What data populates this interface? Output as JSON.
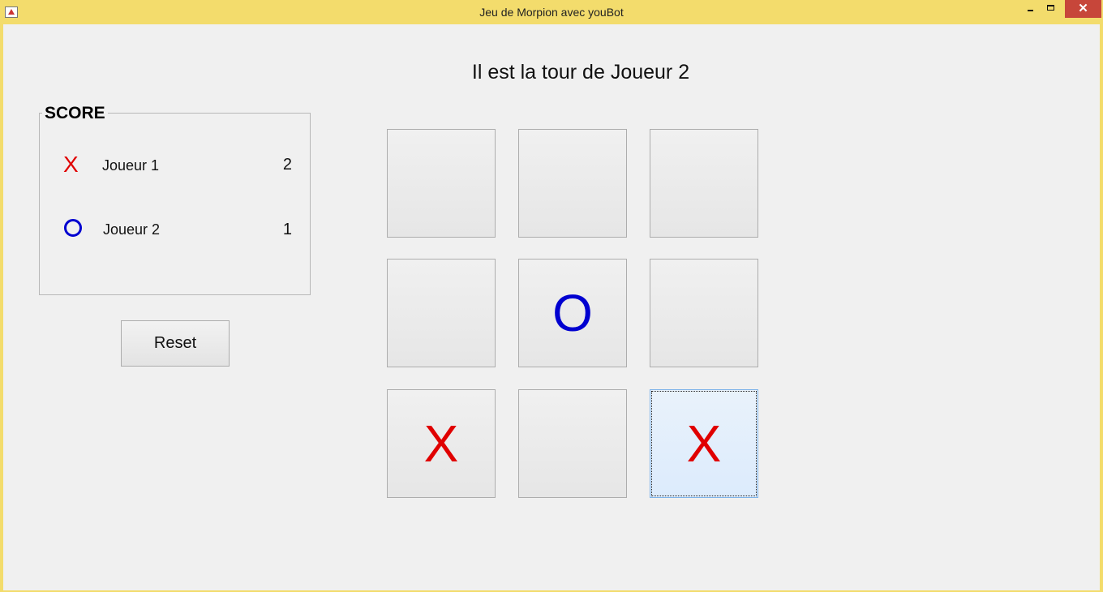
{
  "window": {
    "title": "Jeu de Morpion avec youBot",
    "close_label": "✕"
  },
  "status": {
    "turn_text": "Il est la tour de Joueur 2"
  },
  "score": {
    "title": "SCORE",
    "players": [
      {
        "symbol": "X",
        "name": "Joueur 1",
        "score": "2",
        "color": "#e00000"
      },
      {
        "symbol": "O",
        "name": "Joueur  2",
        "score": "1",
        "color": "#0000d0"
      }
    ]
  },
  "controls": {
    "reset_label": "Reset"
  },
  "board": {
    "cells": [
      "",
      "",
      "",
      "",
      "O",
      "",
      "X",
      "",
      "X"
    ],
    "selected_cell": 8
  }
}
